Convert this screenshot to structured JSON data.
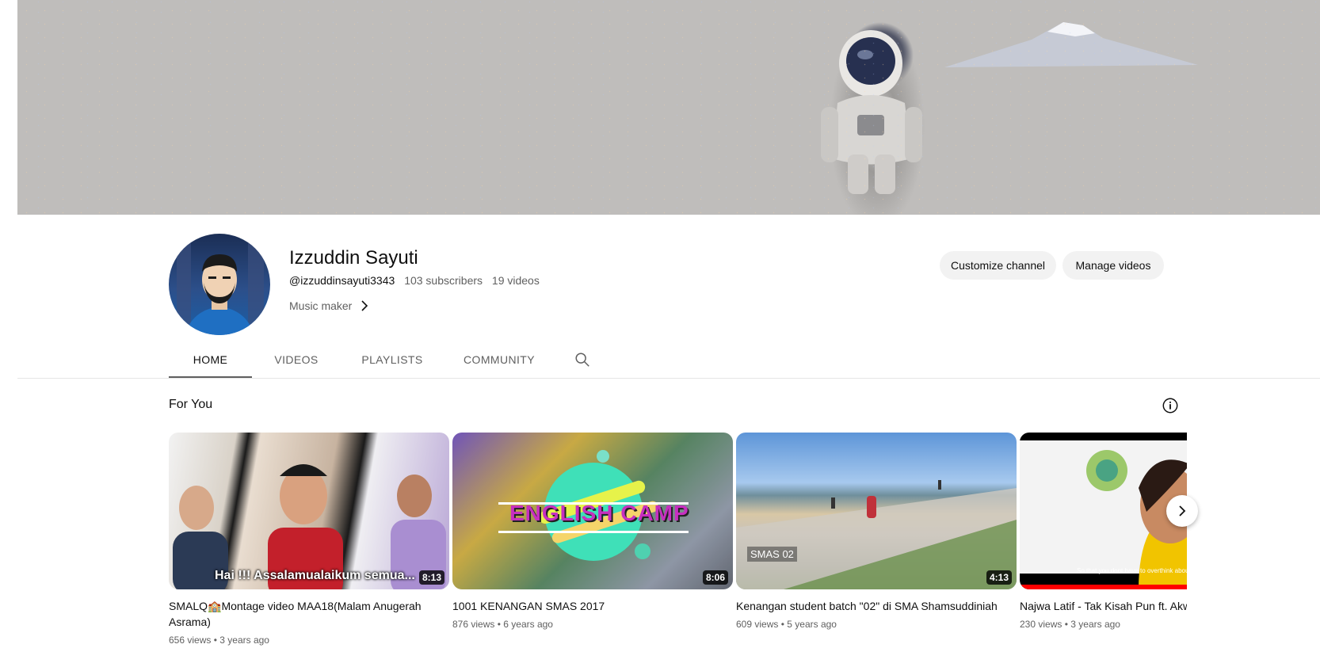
{
  "channel": {
    "name": "Izzuddin Sayuti",
    "handle": "@izzuddinsayuti3343",
    "subscribers": "103 subscribers",
    "videos": "19 videos",
    "description": "Music maker"
  },
  "actions": {
    "customize": "Customize channel",
    "manage": "Manage videos"
  },
  "tabs": [
    {
      "label": "HOME",
      "active": true
    },
    {
      "label": "VIDEOS",
      "active": false
    },
    {
      "label": "PLAYLISTS",
      "active": false
    },
    {
      "label": "COMMUNITY",
      "active": false
    }
  ],
  "section": {
    "title": "For You"
  },
  "videos": [
    {
      "title": "SMALQ🏫Montage video MAA18(Malam Anugerah Asrama)",
      "views": "656 views",
      "age": "3 years ago",
      "duration": "8:13",
      "overlay_text": "Hai !!! Assalamualaikum semua..."
    },
    {
      "title": "1001 KENANGAN SMAS 2017",
      "views": "876 views",
      "age": "6 years ago",
      "duration": "8:06",
      "overlay_text": "ENGLISH CAMP"
    },
    {
      "title": "Kenangan student batch \"02\" di SMA Shamsuddiniah",
      "views": "609 views",
      "age": "5 years ago",
      "duration": "4:13",
      "overlay_text": "SMAS 02"
    },
    {
      "title": "Najwa Latif - Tak Kisah Pun ft. Akwa Remix )",
      "views": "230 views",
      "age": "3 years ago",
      "duration": "",
      "overlay_text": "So that you dont have to overthink about"
    }
  ],
  "icons": {
    "search": "search-icon",
    "info": "info-icon",
    "next": "chevron-right-icon",
    "description_more": "chevron-right-icon"
  },
  "colors": {
    "text_primary": "#0f0f0f",
    "text_secondary": "#606060",
    "button_bg": "#f2f2f2"
  }
}
